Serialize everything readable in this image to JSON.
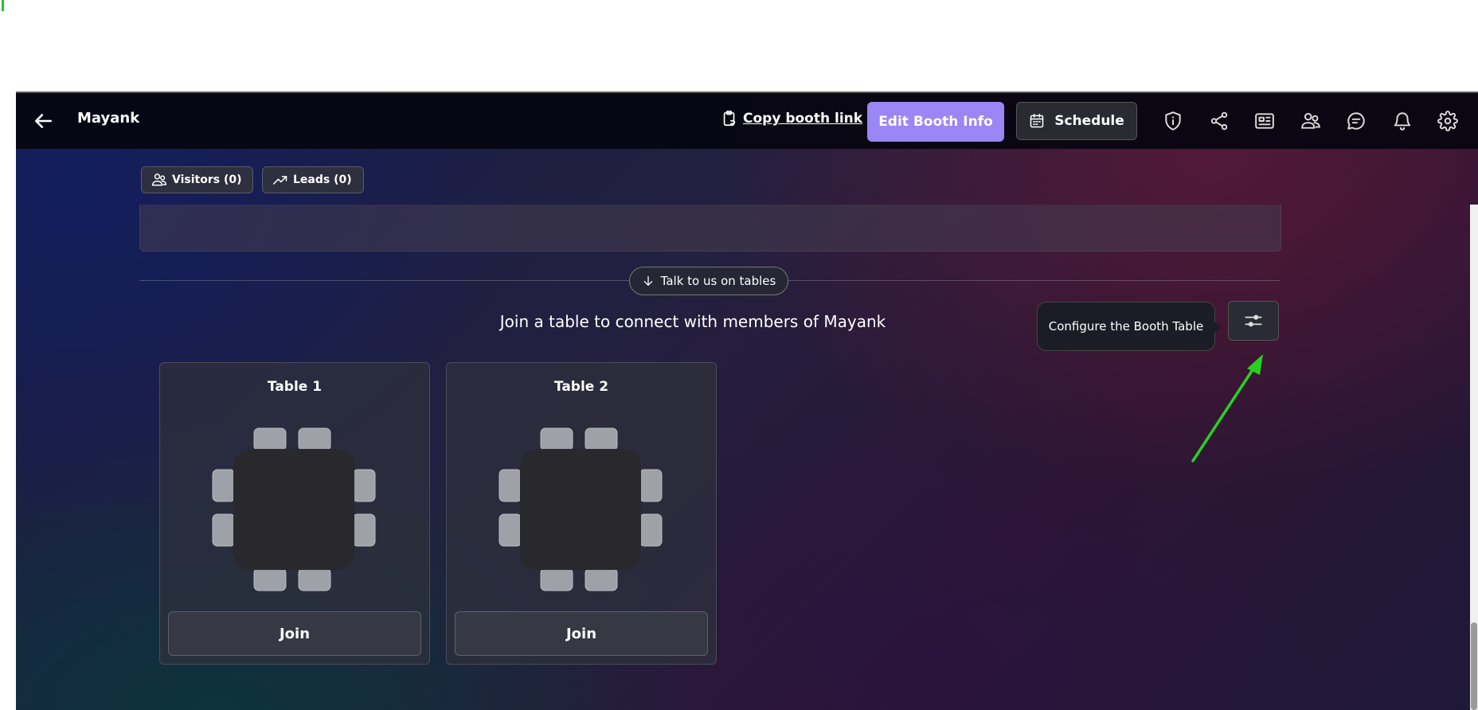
{
  "header": {
    "booth_name": "Mayank",
    "copy_link_label": "Copy booth link",
    "edit_booth_label": "Edit Booth Info",
    "schedule_label": "Schedule",
    "accent_color": "#9a86f5"
  },
  "stats": {
    "visitors_label": "Visitors (0)",
    "leads_label": "Leads (0)"
  },
  "tables_section": {
    "talk_button_label": "Talk to us on tables",
    "heading": "Join a table to connect with members of Mayank",
    "configure_tooltip": "Configure the Booth Table",
    "tables": [
      {
        "name": "Table 1",
        "join_label": "Join",
        "seats": 8
      },
      {
        "name": "Table 2",
        "join_label": "Join",
        "seats": 8
      }
    ]
  },
  "annotation": {
    "arrow_color": "#28d11f"
  }
}
